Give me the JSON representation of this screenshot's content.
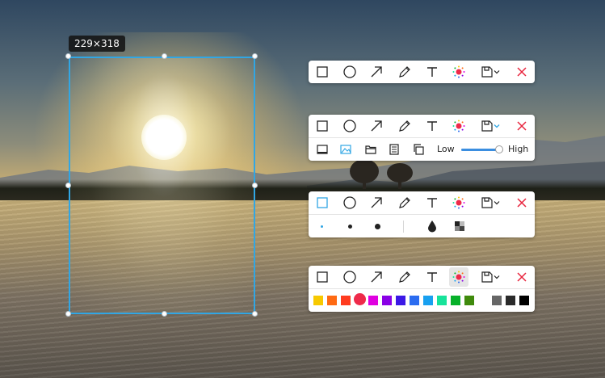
{
  "screenshot": {
    "size_label": "229×318"
  },
  "tools": [
    "rectangle",
    "ellipse",
    "arrow",
    "pencil",
    "text",
    "color",
    "save",
    "close"
  ],
  "toolbar_2": {
    "quality_low": "Low",
    "quality_high": "High",
    "quality_level": 0.9
  },
  "toolbar_3": {
    "brush_sizes": [
      "small",
      "medium",
      "large"
    ]
  },
  "toolbar_4": {
    "colors": [
      "#f7c900",
      "#ff6a13",
      "#ff3b1f",
      "#ee2a4a",
      "#e000e0",
      "#8a00e6",
      "#3b18e6",
      "#2b6cf0",
      "#18a0f0",
      "#17e39a",
      "#07b12a",
      "#3f8a0c",
      "#ffffff",
      "#666666",
      "#2a2a2a",
      "#000000"
    ],
    "selected_color": "#ee2a4a"
  },
  "accent": "#31a6e4",
  "close_color": "#e8253e"
}
